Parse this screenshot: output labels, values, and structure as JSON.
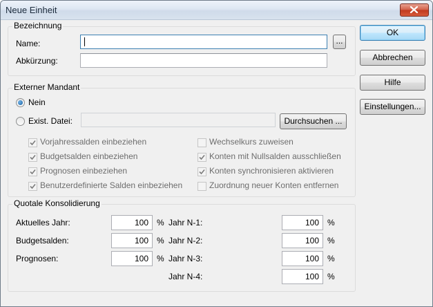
{
  "window": {
    "title": "Neue Einheit",
    "close_icon": "close-x-icon"
  },
  "bezeichnung": {
    "group_label": "Bezeichnung",
    "name_label": "Name:",
    "name_value": "",
    "browse_label": "...",
    "abk_label": "Abkürzung:",
    "abk_value": ""
  },
  "externer": {
    "group_label": "Externer Mandant",
    "radio_nein": "Nein",
    "radio_nein_selected": true,
    "radio_datei": "Exist. Datei:",
    "datei_value": "",
    "browse_label": "Durchsuchen ...",
    "options_left": [
      {
        "label": "Vorjahressalden einbeziehen",
        "checked": true
      },
      {
        "label": "Budgetsalden einbeziehen",
        "checked": true
      },
      {
        "label": "Prognosen einbeziehen",
        "checked": true
      },
      {
        "label": "Benutzerdefinierte Salden einbeziehen",
        "checked": true
      }
    ],
    "options_right": [
      {
        "label": "Wechselkurs zuweisen",
        "checked": false
      },
      {
        "label": "Konten mit Nullsalden ausschließen",
        "checked": true
      },
      {
        "label": "Konten synchronisieren aktivieren",
        "checked": true
      },
      {
        "label": "Zuordnung neuer Konten entfernen",
        "checked": false
      }
    ]
  },
  "quotale": {
    "group_label": "Quotale Konsolidierung",
    "left": [
      {
        "label": "Aktuelles Jahr:",
        "value": "100",
        "unit": "%"
      },
      {
        "label": "Budgetsalden:",
        "value": "100",
        "unit": "%"
      },
      {
        "label": "Prognosen:",
        "value": "100",
        "unit": "%"
      }
    ],
    "right": [
      {
        "label": "Jahr N-1:",
        "value": "100",
        "unit": "%"
      },
      {
        "label": "Jahr N-2:",
        "value": "100",
        "unit": "%"
      },
      {
        "label": "Jahr N-3:",
        "value": "100",
        "unit": "%"
      },
      {
        "label": "Jahr N-4:",
        "value": "100",
        "unit": "%"
      }
    ]
  },
  "buttons": {
    "ok": "OK",
    "abbrechen": "Abbrechen",
    "hilfe": "Hilfe",
    "einstellungen": "Einstellungen..."
  },
  "colors": {
    "accent": "#3c7fb1",
    "close": "#c0391f",
    "check": "#7d7d7d"
  }
}
